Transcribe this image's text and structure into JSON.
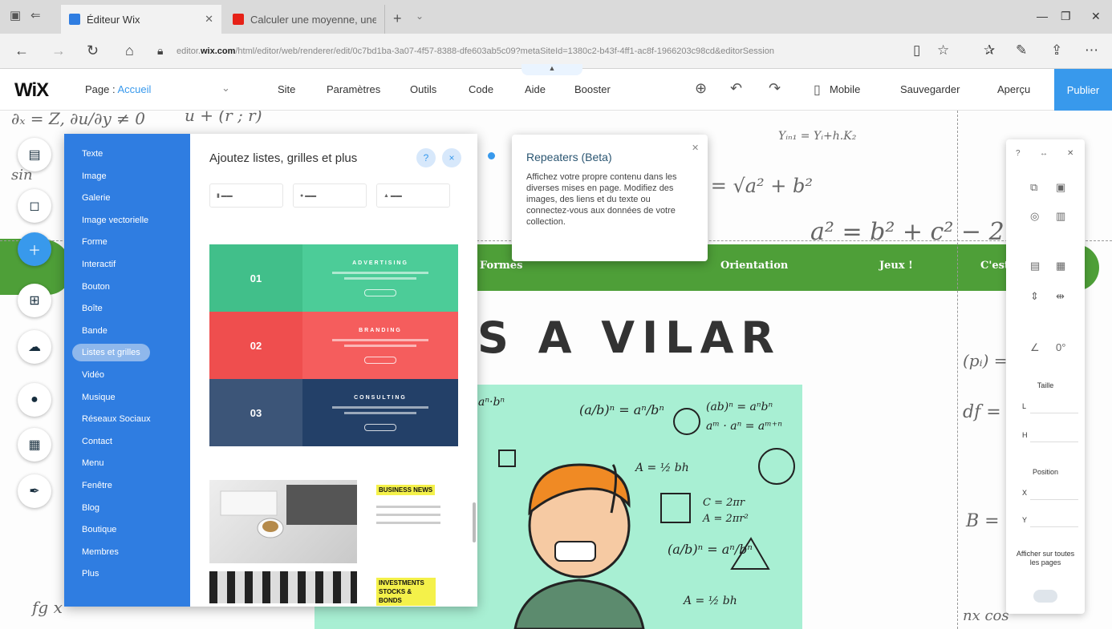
{
  "browser": {
    "tabs": [
      {
        "title": "Éditeur Wix",
        "icon": "wix-favicon"
      },
      {
        "title": "Calculer une moyenne, une",
        "icon": "youtube-favicon"
      }
    ],
    "url_host": "wix.com",
    "url_prefix": "editor.",
    "url_rest": "/html/editor/web/renderer/edit/0c7bd1ba-3a07-4f57-8388-dfe603ab5c09?metaSiteId=1380c2-b43f-4ff1-ac8f-1966203c98cd&editorSession",
    "icons": [
      "back-icon",
      "forward-icon",
      "refresh-icon",
      "home-icon",
      "lock-icon",
      "reading-view-icon",
      "star-icon",
      "favorites-icon",
      "pen-icon",
      "share-icon",
      "more-icon"
    ]
  },
  "wix": {
    "logo": "WiX",
    "page_label": "Page :",
    "page_name": "Accueil",
    "menu": [
      "Site",
      "Paramètres",
      "Outils",
      "Code",
      "Aide",
      "Booster"
    ],
    "mobile": "Mobile",
    "save": "Sauvegarder",
    "preview": "Aperçu",
    "publish": "Publier"
  },
  "add_panel": {
    "categories": [
      "Texte",
      "Image",
      "Galerie",
      "Image vectorielle",
      "Forme",
      "Interactif",
      "Bouton",
      "Boîte",
      "Bande",
      "Listes et grilles",
      "Vidéo",
      "Musique",
      "Réseaux Sociaux",
      "Contact",
      "Menu",
      "Fenêtre",
      "Blog",
      "Boutique",
      "Membres",
      "Plus"
    ],
    "selected_category": "Listes et grilles",
    "title": "Ajoutez listes, grilles et plus",
    "help_label": "?",
    "close_label": "×",
    "template_rows": [
      {
        "num": "01",
        "heading": "ADVERTISING",
        "color": "#4ccc98"
      },
      {
        "num": "02",
        "heading": "BRANDING",
        "color": "#f55d5d"
      },
      {
        "num": "03",
        "heading": "CONSULTING",
        "color": "#234068"
      }
    ],
    "news_tags": [
      "BUSINESS NEWS",
      "INVESTMENTS STOCKS & BONDS"
    ]
  },
  "tooltip": {
    "title": "Repeaters (Beta)",
    "body": "Affichez votre propre contenu dans les diverses mises en page. Modifiez des images, des liens et du texte ou connectez-vous aux données de votre collection."
  },
  "site": {
    "nav": [
      "Formes",
      "Orientation",
      "Jeux !",
      "C'est"
    ],
    "headline": "S A VILAR"
  },
  "inspector": {
    "size_label": "Taille",
    "w": "L",
    "h": "H",
    "position_label": "Position",
    "x": "X",
    "y": "Y",
    "show_all_pages": "Afficher sur toutes les pages"
  },
  "colors": {
    "wix_blue": "#3899ec",
    "panel_blue": "#2f7de1",
    "band_green": "#4e9f38",
    "math_bg": "#a8efd3"
  }
}
